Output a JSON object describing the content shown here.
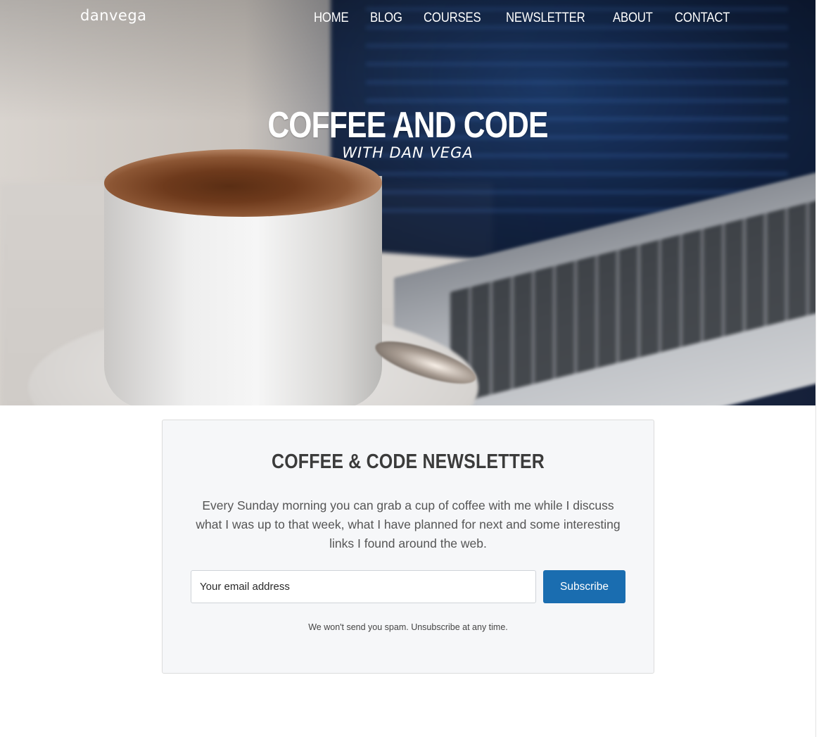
{
  "nav": {
    "logo": "danvega",
    "items": [
      {
        "label": "HOME"
      },
      {
        "label": "BLOG"
      },
      {
        "label": "COURSES"
      },
      {
        "label": "NEWSLETTER"
      },
      {
        "label": "ABOUT"
      },
      {
        "label": "CONTACT"
      }
    ]
  },
  "hero": {
    "title": "COFFEE AND CODE",
    "subtitle": "WITH DAN VEGA",
    "image_icon": "coffee-laptop-photo"
  },
  "newsletter": {
    "title": "COFFEE & CODE NEWSLETTER",
    "description": "Every Sunday morning you can grab a cup of coffee with me while I discuss what I was up to that week, what I have planned for next and some interesting links I found around the web.",
    "email_placeholder": "Your email address",
    "subscribe_label": "Subscribe",
    "disclaimer": "We won't send you spam. Unsubscribe at any time."
  },
  "colors": {
    "accent": "#1a6db0",
    "card_bg": "#f6f7f9",
    "title_text": "#3b3b3b"
  }
}
